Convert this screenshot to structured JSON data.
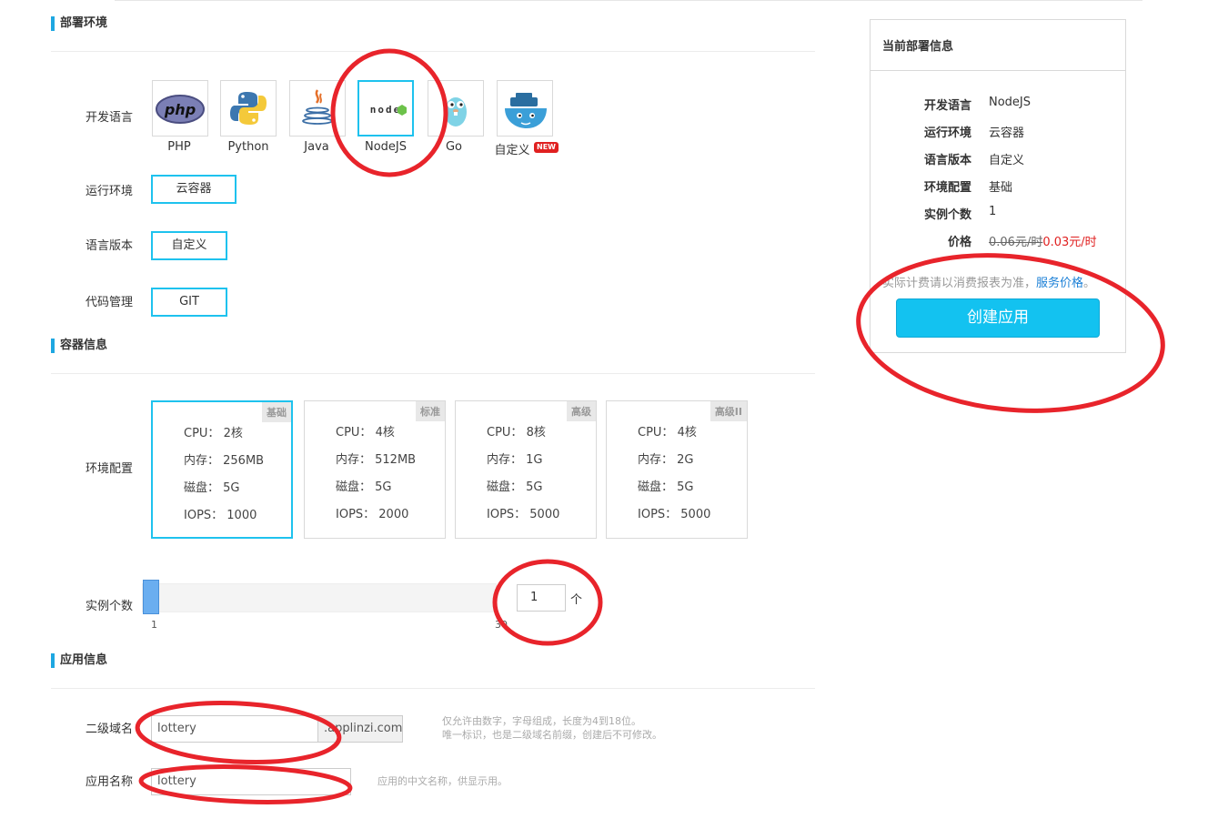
{
  "deploy": {
    "section_title": "部署环境",
    "language_label": "开发语言",
    "languages": [
      {
        "name": "PHP",
        "icon": "php-icon"
      },
      {
        "name": "Python",
        "icon": "python-icon"
      },
      {
        "name": "Java",
        "icon": "java-icon"
      },
      {
        "name": "NodeJS",
        "icon": "nodejs-icon",
        "logo_text": "node"
      },
      {
        "name": "Go",
        "icon": "go-gopher-icon"
      },
      {
        "name": "自定义",
        "icon": "docker-whale-icon",
        "badge": "NEW"
      }
    ],
    "selected_language": "NodeJS",
    "runtime_label": "运行环境",
    "runtime_value": "云容器",
    "version_label": "语言版本",
    "version_value": "自定义",
    "code_label": "代码管理",
    "code_value": "GIT"
  },
  "container": {
    "section_title": "容器信息",
    "env_label": "环境配置",
    "configs": [
      {
        "tag": "基础",
        "cpu": "CPU： 2核",
        "mem": "内存： 256MB",
        "disk": "磁盘： 5G",
        "iops": "IOPS： 1000"
      },
      {
        "tag": "标准",
        "cpu": "CPU： 4核",
        "mem": "内存： 512MB",
        "disk": "磁盘： 5G",
        "iops": "IOPS： 2000"
      },
      {
        "tag": "高级",
        "cpu": "CPU： 8核",
        "mem": "内存： 1G",
        "disk": "磁盘： 5G",
        "iops": "IOPS： 5000"
      },
      {
        "tag": "高级II",
        "cpu": "CPU： 4核",
        "mem": "内存： 2G",
        "disk": "磁盘： 5G",
        "iops": "IOPS： 5000"
      }
    ],
    "selected_config": "基础",
    "instance_label": "实例个数",
    "slider_min": "1",
    "slider_max": "30",
    "instance_value": "1",
    "instance_unit": "个"
  },
  "app": {
    "section_title": "应用信息",
    "subdomain_label": "二级域名",
    "subdomain_value": "lottery",
    "domain_suffix": ".applinzi.com",
    "subdomain_hint_1": "仅允许由数字，字母组成，长度为4到18位。",
    "subdomain_hint_2": "唯一标识，也是二级域名前缀，创建后不可修改。",
    "name_label": "应用名称",
    "name_value": "lottery",
    "name_hint": "应用的中文名称，供显示用。"
  },
  "summary": {
    "title": "当前部署信息",
    "rows": [
      {
        "label": "开发语言",
        "value": "NodeJS"
      },
      {
        "label": "运行环境",
        "value": "云容器"
      },
      {
        "label": "语言版本",
        "value": "自定义"
      },
      {
        "label": "环境配置",
        "value": "基础"
      },
      {
        "label": "实例个数",
        "value": "1"
      }
    ],
    "price_label": "价格",
    "price_old": "0.06元/时",
    "price_new": "0.03元/时",
    "notice_text": "实际计费请以消费报表为准，",
    "notice_link": "服务价格",
    "notice_end": "。",
    "create_button": "创建应用"
  },
  "colors": {
    "accent": "#1ec2ee",
    "button": "#13c2f0",
    "annotation": "#e8242b",
    "price_red": "#e02020"
  }
}
